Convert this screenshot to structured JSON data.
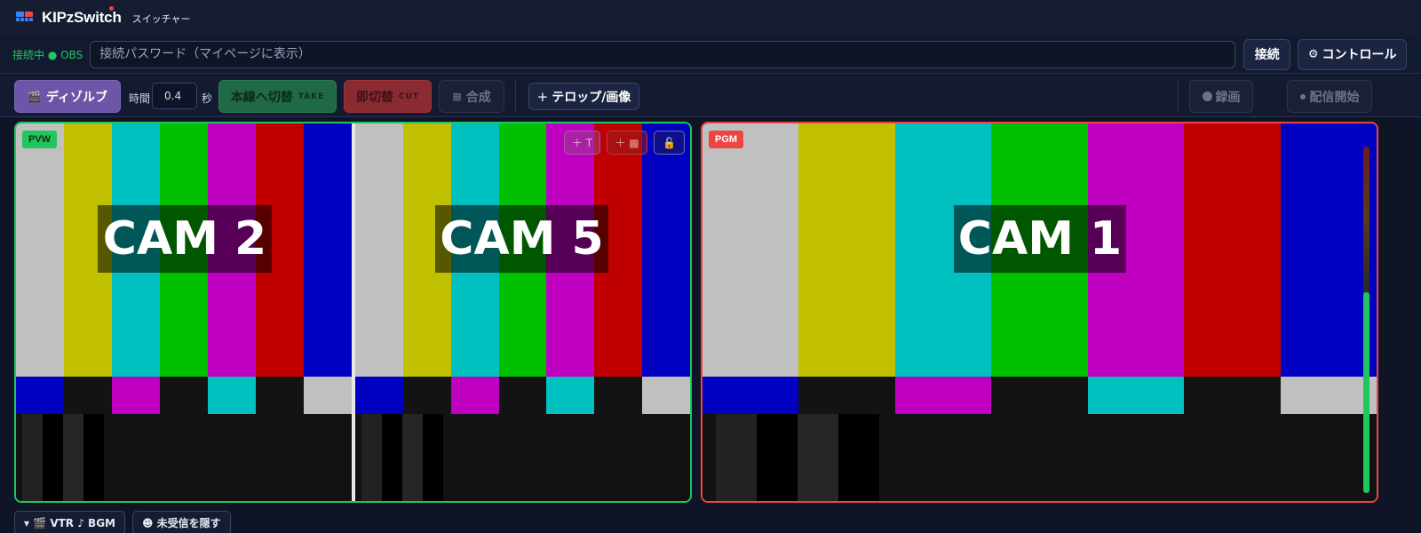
{
  "app": {
    "brand": "KIPzSwitch",
    "subtitle": "スイッチャー"
  },
  "connection": {
    "status": "接続中 ● OBS",
    "password_placeholder": "接続パスワード（マイページに表示）",
    "password_value": "",
    "connect_label": "接続",
    "control_label": "コントロール"
  },
  "toolbar": {
    "dissolve_label": "ディゾルブ",
    "time_label": "時間",
    "time_value": "0.4",
    "sec_label": "秒",
    "take_label": "本線へ切替",
    "take_sub": "TAKE",
    "cut_label": "即切替",
    "cut_sub": "CUT",
    "composite_label": "合成",
    "telop_label": "テロップ/画像",
    "rec_label": "録画",
    "live_label": "配信開始"
  },
  "preview": {
    "badge": "PVW",
    "feeds": [
      {
        "label": "CAM 2"
      },
      {
        "label": "CAM 5"
      }
    ],
    "add_text_label": "＋ T",
    "add_image_label": "＋ ▩",
    "lock_icon": "🔓"
  },
  "program": {
    "badge": "PGM",
    "feeds": [
      {
        "label": "CAM 1"
      }
    ],
    "audio_level": 0.58
  },
  "test_pattern": {
    "top": [
      "#c0c0c0",
      "#c0c000",
      "#00c0c0",
      "#00c000",
      "#c000c0",
      "#c00000",
      "#0000c0"
    ],
    "mid": [
      "#0000c0",
      "#131313",
      "#c000c0",
      "#131313",
      "#00c0c0",
      "#131313",
      "#c0c0c0"
    ]
  },
  "bottom": {
    "vtr_label": "▾ 🎬 VTR ♪ BGM",
    "unreceived_label": "☻ 未受信を隠す"
  },
  "colors": {
    "pvw": "#22c55e",
    "pgm": "#ef4444",
    "accent": "#6d55a8"
  }
}
